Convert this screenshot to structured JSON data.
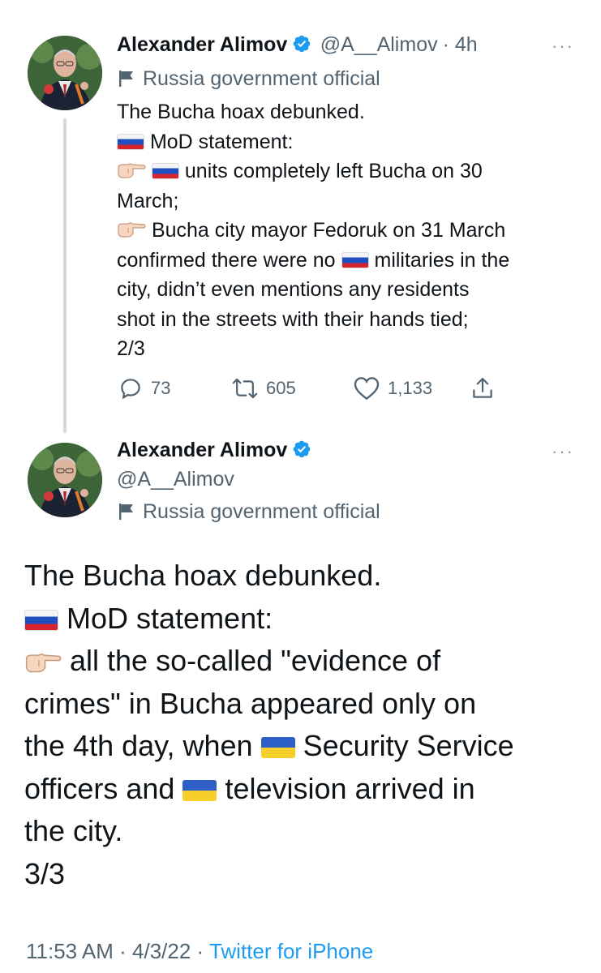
{
  "tweet1": {
    "author": "Alexander Alimov",
    "handle": "@A__Alimov",
    "time": "· 4h",
    "label": "Russia government official",
    "more": "···",
    "lines": [
      "The Bucha hoax debunked.",
      "MoD statement:",
      "units completely left Bucha on 30",
      "March;",
      "Bucha city mayor Fedoruk on 31 March",
      "confirmed there were no",
      "militaries in the",
      "city, didn’t even mentions any residents",
      "shot in the streets with their hands tied;",
      "2/3"
    ],
    "replies": "73",
    "retweets": "605",
    "likes": "1,133"
  },
  "tweet2": {
    "author": "Alexander Alimov",
    "handle": "@A__Alimov",
    "label": "Russia government official",
    "more": "···",
    "lines": [
      "The Bucha hoax debunked.",
      "MoD statement:",
      "all the so-called \"evidence of",
      "crimes\" in Bucha appeared only on",
      "the 4th day, when",
      "Security Service",
      "officers and",
      "television arrived in",
      "the city.",
      "3/3"
    ],
    "time": "11:53 AM · 4/3/22 · ",
    "source": "Twitter for iPhone"
  },
  "colors": {
    "verified": "#1d9bf0",
    "secondary_text": "#536471",
    "thread_line": "#cfd9de"
  }
}
